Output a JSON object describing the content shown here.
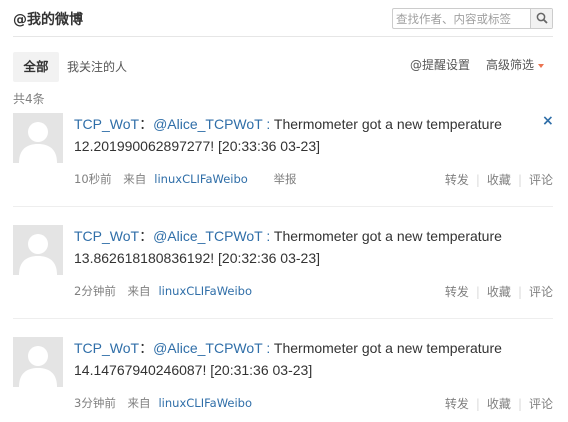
{
  "header": {
    "title": "@我的微博",
    "search_placeholder": "查找作者、内容或标签"
  },
  "tabs": {
    "all": "全部",
    "following": "我关注的人",
    "remind_settings": "@提醒设置",
    "advanced_filter": "高级筛选"
  },
  "count_text": "共4条",
  "colors": {
    "link": "#2f6ea8",
    "accent": "#eb7350",
    "muted": "#808080"
  },
  "posts": [
    {
      "author": "TCP_WoT",
      "colon": "：",
      "mention": "@Alice_TCPWoT",
      "sep": " : ",
      "line1": "Thermometer got a new temperature",
      "line2": "12.201990062897277! [20:33:36 03-23]",
      "time": "10秒前",
      "source_prefix": "来自",
      "source": "linuxCLIFaWeibo",
      "report": "举报",
      "repost": "转发",
      "favorite": "收藏",
      "comment": "评论",
      "close": "×"
    },
    {
      "author": "TCP_WoT",
      "colon": "：",
      "mention": "@Alice_TCPWoT",
      "sep": " : ",
      "line1": "Thermometer got a new temperature",
      "line2": "13.862618180836192! [20:32:36 03-23]",
      "time": "2分钟前",
      "source_prefix": "来自",
      "source": "linuxCLIFaWeibo",
      "repost": "转发",
      "favorite": "收藏",
      "comment": "评论"
    },
    {
      "author": "TCP_WoT",
      "colon": "：",
      "mention": "@Alice_TCPWoT",
      "sep": " : ",
      "line1": "Thermometer got a new temperature",
      "line2": "14.14767940246087! [20:31:36 03-23]",
      "time": "3分钟前",
      "source_prefix": "来自",
      "source": "linuxCLIFaWeibo",
      "repost": "转发",
      "favorite": "收藏",
      "comment": "评论"
    }
  ]
}
